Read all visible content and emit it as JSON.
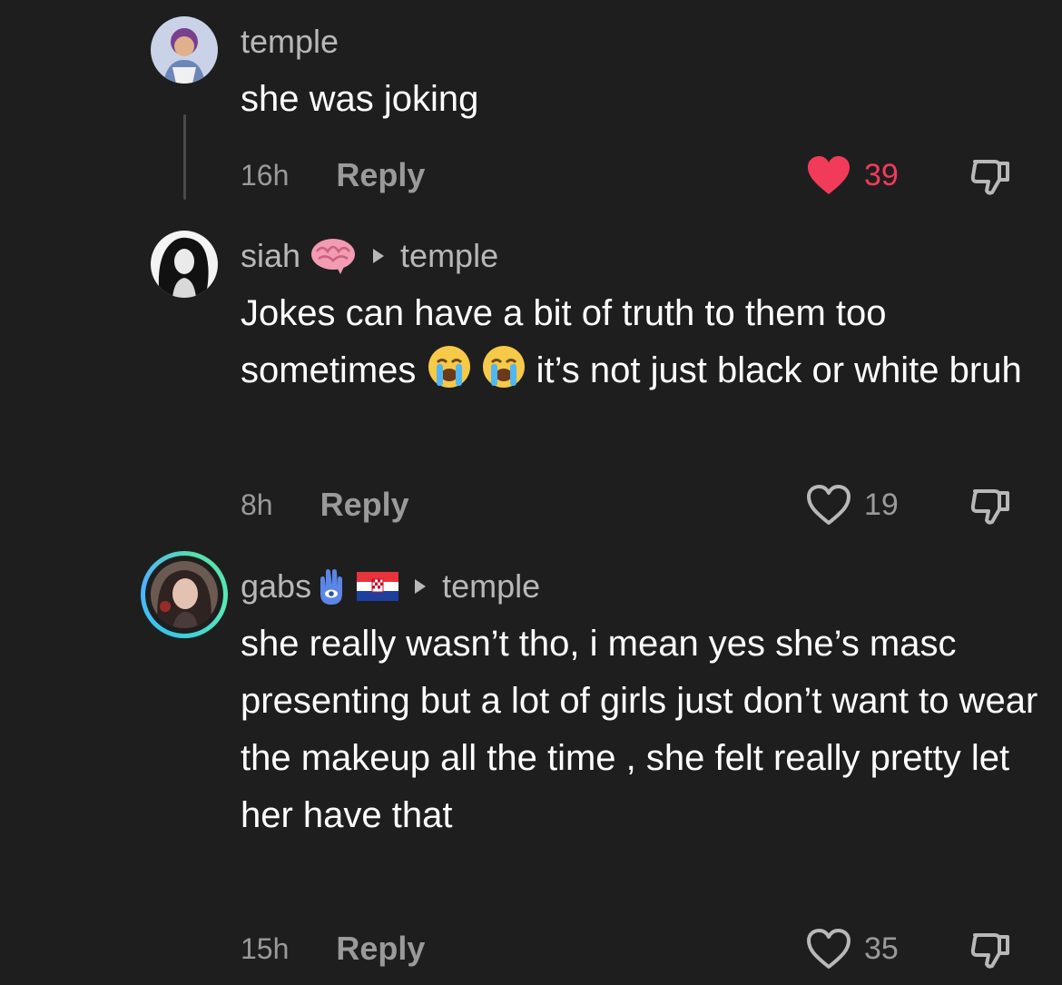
{
  "comments": [
    {
      "username": "temple",
      "text": "she was joking",
      "time": "16h",
      "reply_label": "Reply",
      "likes": "39",
      "liked": true
    },
    {
      "username": "siah",
      "reply_to": "temple",
      "text_parts": [
        "Jokes can have a bit of truth to them too sometimes ",
        " it’s not just black or white bruh"
      ],
      "time": "8h",
      "reply_label": "Reply",
      "likes": "19",
      "liked": false
    },
    {
      "username": "gabs",
      "reply_to": "temple",
      "text": "she really wasn’t tho, i mean yes she’s masc presenting but a lot of girls just don’t want to wear the makeup all the time , she felt really pretty let her have that",
      "time": "15h",
      "reply_label": "Reply",
      "likes": "35",
      "liked": false
    }
  ],
  "colors": {
    "background": "#1e1e1e",
    "liked": "#f23b5a",
    "muted": "#9a9a9a"
  },
  "icons": {
    "like": "heart-icon",
    "dislike": "thumbs-down-icon",
    "reply_arrow": "play-arrow-icon",
    "emoji_brain": "brain-emoji",
    "emoji_crying": "loudly-crying-face-emoji",
    "emoji_hamsa": "hamsa-emoji",
    "emoji_flag": "croatia-flag-emoji"
  }
}
